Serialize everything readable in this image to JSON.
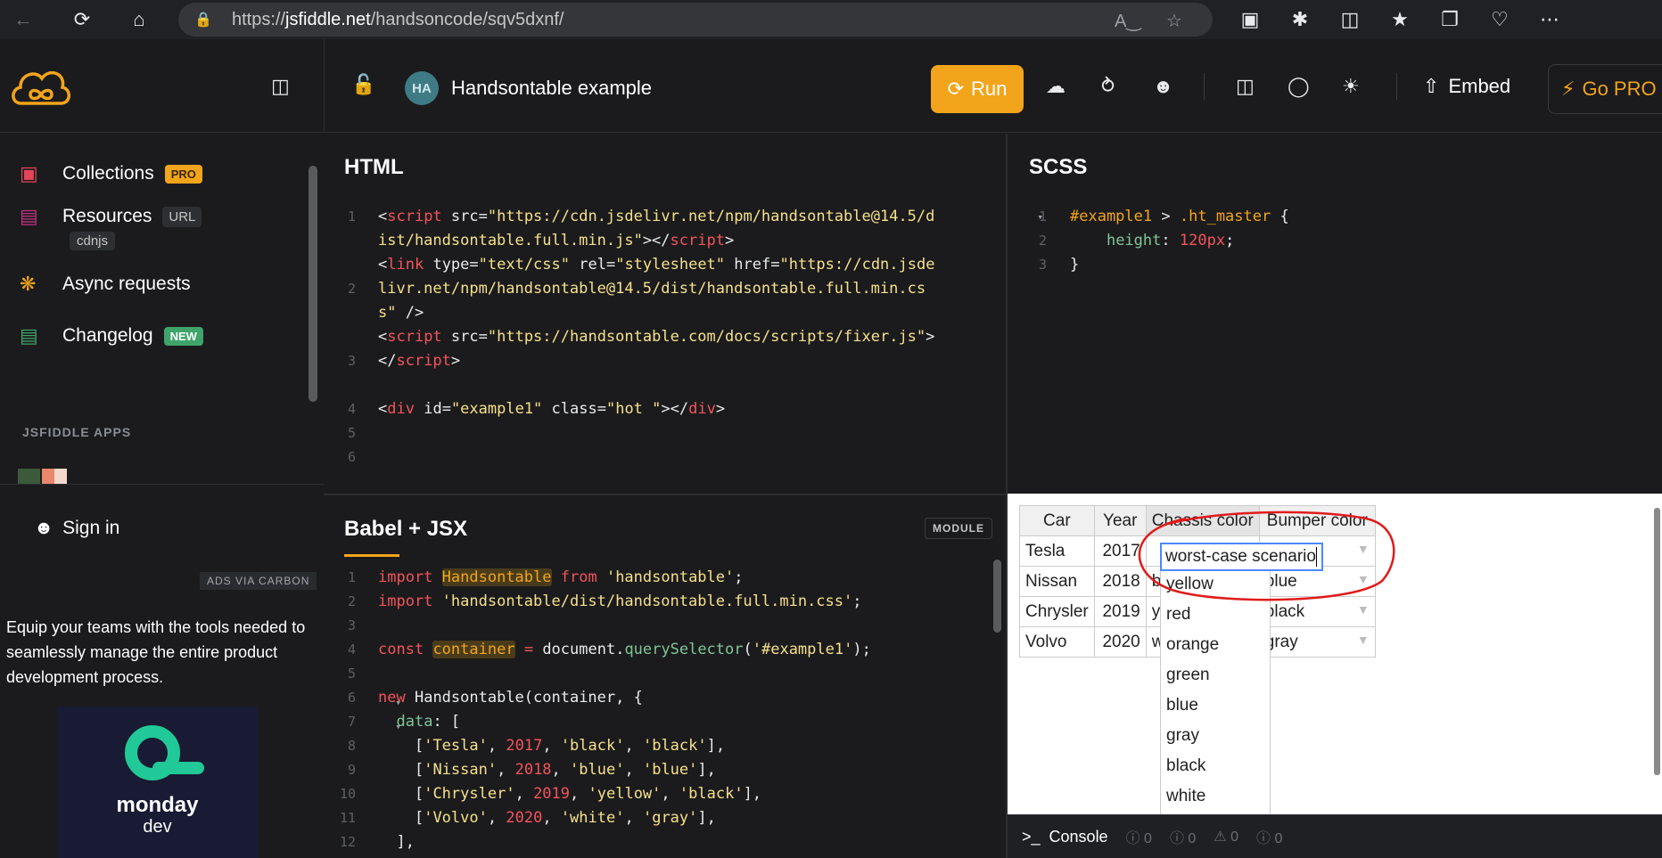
{
  "browser": {
    "url_prefix": "https://",
    "url_host": "jsfiddle.net",
    "url_path": "/handsoncode/sqv5dxnf/"
  },
  "header": {
    "avatar_initials": "HA",
    "title": "Handsontable example",
    "run_label": "Run",
    "embed_label": "Embed",
    "gopro_label": "Go PRO"
  },
  "sidebar": {
    "collections": "Collections",
    "collections_badge": "PRO",
    "resources": "Resources",
    "resources_badge": "URL",
    "resources_sub": "cdnjs",
    "async": "Async requests",
    "changelog": "Changelog",
    "changelog_badge": "NEW",
    "apps_title": "JSFIDDLE APPS",
    "signin": "Sign in",
    "ads_label": "ADS VIA CARBON",
    "ad_text": "Equip your teams with the tools needed to seamlessly manage the entire product development process.",
    "ad_brand_1": "monday",
    "ad_brand_2": "dev"
  },
  "panels": {
    "html_title": "HTML",
    "scss_title": "SCSS",
    "js_title": "Babel + JSX",
    "module_badge": "MODULE"
  },
  "table": {
    "headers": [
      "Car",
      "Year",
      "Chassis color",
      "Bumper color"
    ],
    "rows": [
      [
        "Tesla",
        "2017",
        "",
        "black"
      ],
      [
        "Nissan",
        "2018",
        "blue",
        "blue"
      ],
      [
        "Chrysler",
        "2019",
        "yellow",
        "black"
      ],
      [
        "Volvo",
        "2020",
        "white",
        "gray"
      ]
    ],
    "editor_value": "worst-case scenario",
    "dropdown_options": [
      "yellow",
      "red",
      "orange",
      "green",
      "blue",
      "gray",
      "black",
      "white"
    ]
  },
  "console": {
    "label": "Console",
    "count_1": "0",
    "count_2": "0",
    "count_3": "0",
    "count_4": "0"
  },
  "colors": {
    "accent": "#f2a51a",
    "annotation": "#e01b1b"
  }
}
